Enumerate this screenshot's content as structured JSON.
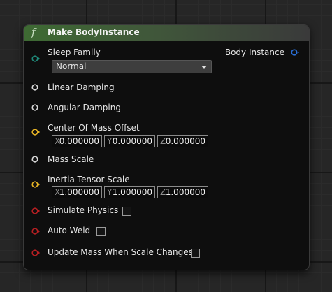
{
  "node": {
    "title": "Make BodyInstance",
    "function_icon": "f",
    "header_color": "#3e6a33",
    "pins": [
      {
        "label": "Sleep Family",
        "pin_color": "#1f8a7a"
      },
      {
        "label": "Linear Damping",
        "pin_color": "#d8d8d8"
      },
      {
        "label": "Angular Damping",
        "pin_color": "#d8d8d8"
      },
      {
        "label": "Center Of Mass Offset",
        "pin_color": "#e6b325"
      },
      {
        "label": "Mass Scale",
        "pin_color": "#d8d8d8"
      },
      {
        "label": "Inertia Tensor Scale",
        "pin_color": "#e6b325"
      },
      {
        "label": "Simulate Physics",
        "pin_color": "#b61f22"
      },
      {
        "label": "Auto Weld",
        "pin_color": "#b61f22"
      },
      {
        "label": "Update Mass When Scale Changes",
        "pin_color": "#b61f22"
      }
    ],
    "sleep_family_value": "Normal",
    "center_of_mass": {
      "x": "0.000000",
      "y": "0.000000",
      "z": "0.000000"
    },
    "inertia_tensor": {
      "x": "1.000000",
      "y": "1.000000",
      "z": "1.000000"
    },
    "axis_labels": {
      "x": "X",
      "y": "Y",
      "z": "Z"
    },
    "output": {
      "label": "Body Instance",
      "pin_color": "#2a6fd6"
    }
  }
}
